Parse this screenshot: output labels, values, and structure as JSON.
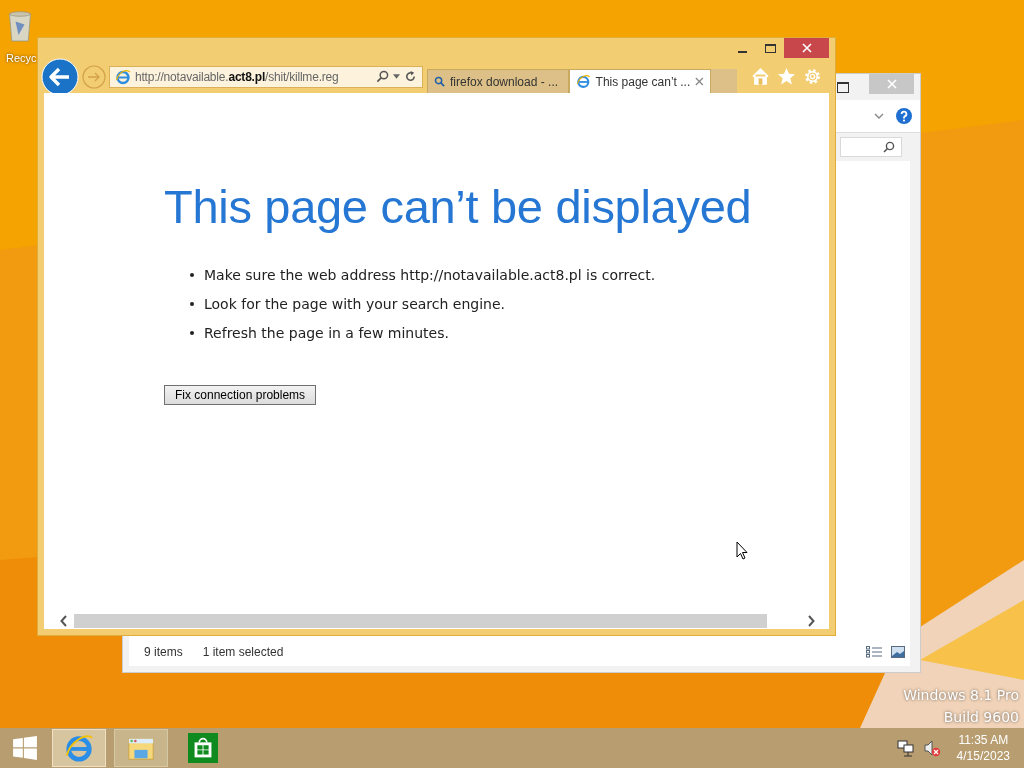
{
  "desktop": {
    "icons": [
      {
        "label": "Recyc"
      }
    ],
    "watermark": [
      "Windows 8.1 Pro",
      "Build 9600"
    ]
  },
  "explorer": {
    "status_items": [
      "9 items",
      "1 item selected"
    ]
  },
  "browser": {
    "address": "http://notavailable.**act8.pl**/shit/killme.reg",
    "tabs": [
      {
        "kind": "search",
        "label": "firefox download - ...",
        "selected": false
      },
      {
        "kind": "page",
        "label": "This page can’t ...",
        "selected": true
      }
    ],
    "page": {
      "heading": "This page can’t be displayed",
      "bullets": [
        "Make sure the web address http://notavailable.act8.pl is correct.",
        "Look for the page with your search engine.",
        "Refresh the page in a few minutes."
      ],
      "button": "Fix connection problems"
    }
  },
  "taskbar": {
    "apps": [
      {
        "kind": "ie",
        "selected": true,
        "running": true
      },
      {
        "kind": "explorer",
        "selected": false,
        "running": true
      },
      {
        "kind": "store",
        "selected": false,
        "running": false
      }
    ],
    "tray": {
      "muted": true
    },
    "clock": {
      "time": "11:35 AM",
      "date": "4/15/2023"
    }
  }
}
